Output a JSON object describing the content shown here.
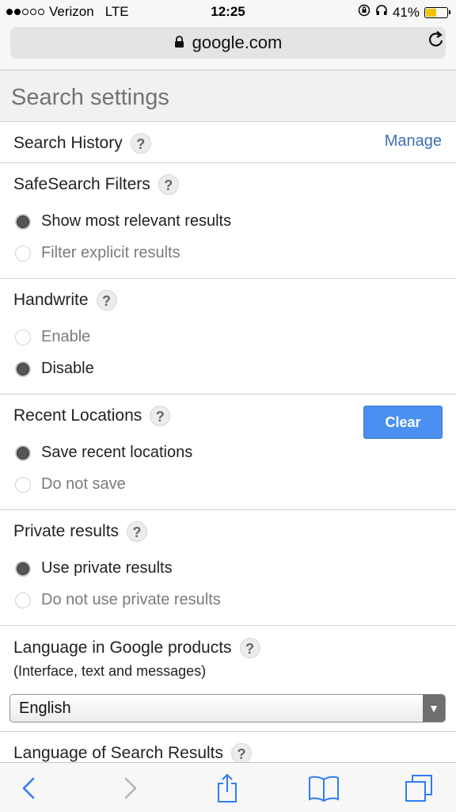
{
  "status_bar": {
    "carrier": "Verizon",
    "network": "LTE",
    "time": "12:25",
    "battery": "41%",
    "battery_color": "#f2c200"
  },
  "address_bar": {
    "url": "google.com",
    "lock_icon": "lock-icon",
    "reload_icon": "reload-icon"
  },
  "page": {
    "title": "Search settings"
  },
  "search_history": {
    "title": "Search History",
    "help": "?",
    "manage_label": "Manage"
  },
  "safesearch": {
    "title": "SafeSearch Filters",
    "help": "?",
    "options": [
      {
        "label": "Show most relevant results",
        "selected": true
      },
      {
        "label": "Filter explicit results",
        "selected": false
      }
    ]
  },
  "handwrite": {
    "title": "Handwrite",
    "help": "?",
    "options": [
      {
        "label": "Enable",
        "selected": false
      },
      {
        "label": "Disable",
        "selected": true
      }
    ]
  },
  "recent_locations": {
    "title": "Recent Locations",
    "help": "?",
    "clear_label": "Clear",
    "options": [
      {
        "label": "Save recent locations",
        "selected": true
      },
      {
        "label": "Do not save",
        "selected": false
      }
    ]
  },
  "private_results": {
    "title": "Private results",
    "help": "?",
    "options": [
      {
        "label": "Use private results",
        "selected": true
      },
      {
        "label": "Do not use private results",
        "selected": false
      }
    ]
  },
  "language_products": {
    "title": "Language in Google products",
    "help": "?",
    "subtitle": "(Interface, text and messages)",
    "selected_value": "English"
  },
  "language_results": {
    "title": "Language of Search Results",
    "help": "?"
  },
  "toolbar": {
    "icons": [
      "back-icon",
      "forward-icon",
      "share-icon",
      "bookmarks-icon",
      "tabs-icon"
    ],
    "accent": "#2f7cf6"
  }
}
